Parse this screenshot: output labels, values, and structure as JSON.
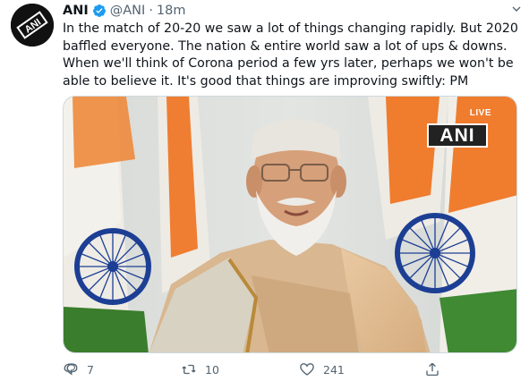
{
  "tweet": {
    "author_name": "ANI",
    "handle": "@ANI",
    "separator": "·",
    "time": "18m",
    "text": "In the match of 20-20 we saw a lot of things changing rapidly. But 2020 baffled everyone. The nation & entire world saw a lot of ups & downs. When we'll think of Corona period a few yrs later, perhaps we won't be able to believe it. It's good that things are improving swiftly: PM"
  },
  "avatar": {
    "logo_text": "ANI"
  },
  "media": {
    "live_label": "LIVE",
    "logo_text": "ANI"
  },
  "actions": {
    "reply_count": "7",
    "retweet_count": "10",
    "like_count": "241"
  },
  "colors": {
    "verified": "#1d9bf0",
    "secondary_text": "#536471",
    "saffron": "#f07c2e",
    "chakra": "#1c3f94"
  }
}
